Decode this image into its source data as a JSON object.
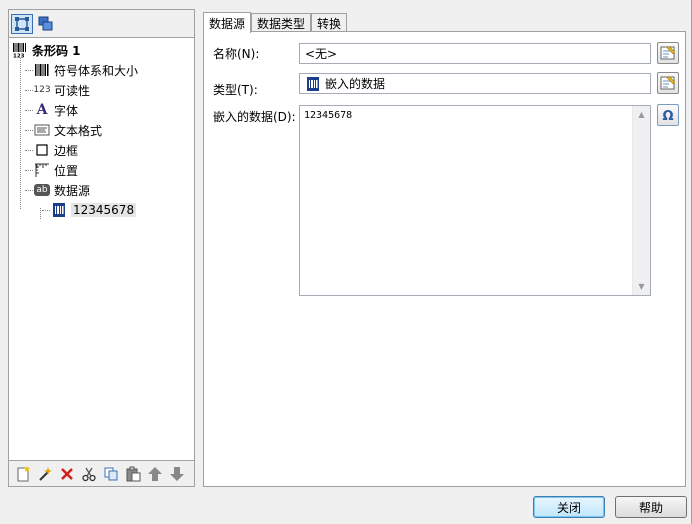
{
  "tree": {
    "root": {
      "label": "条形码 1",
      "icon": "barcode-123-icon"
    },
    "items": [
      {
        "label": "符号体系和大小",
        "icon": "barcode-icon"
      },
      {
        "label": "可读性",
        "icon": "readability-123-icon",
        "icon_text": "123"
      },
      {
        "label": "字体",
        "icon": "font-icon",
        "icon_text": "A"
      },
      {
        "label": "文本格式",
        "icon": "text-format-icon"
      },
      {
        "label": "边框",
        "icon": "border-icon"
      },
      {
        "label": "位置",
        "icon": "position-icon"
      },
      {
        "label": "数据源",
        "icon": "data-source-icon",
        "icon_text": "ab"
      }
    ],
    "data_child": {
      "label": "12345678",
      "icon": "embedded-data-icon"
    }
  },
  "toolbar_bottom": [
    "new-item-icon",
    "wizard-icon",
    "delete-icon",
    "cut-icon",
    "copy-icon",
    "paste-icon",
    "move-up-icon",
    "move-down-icon"
  ],
  "tabs": [
    {
      "label": "数据源",
      "active": true
    },
    {
      "label": "数据类型",
      "active": false
    },
    {
      "label": "转换",
      "active": false
    }
  ],
  "form": {
    "name_label": "名称(N):",
    "name_value": "<无>",
    "type_label": "类型(T):",
    "type_value": "嵌入的数据",
    "data_label": "嵌入的数据(D):",
    "data_value": "12345678"
  },
  "buttons": {
    "close": "关闭",
    "help": "帮助"
  },
  "colors": {
    "accent": "#3c7fb1",
    "selected_bg": "#cde4f7"
  }
}
